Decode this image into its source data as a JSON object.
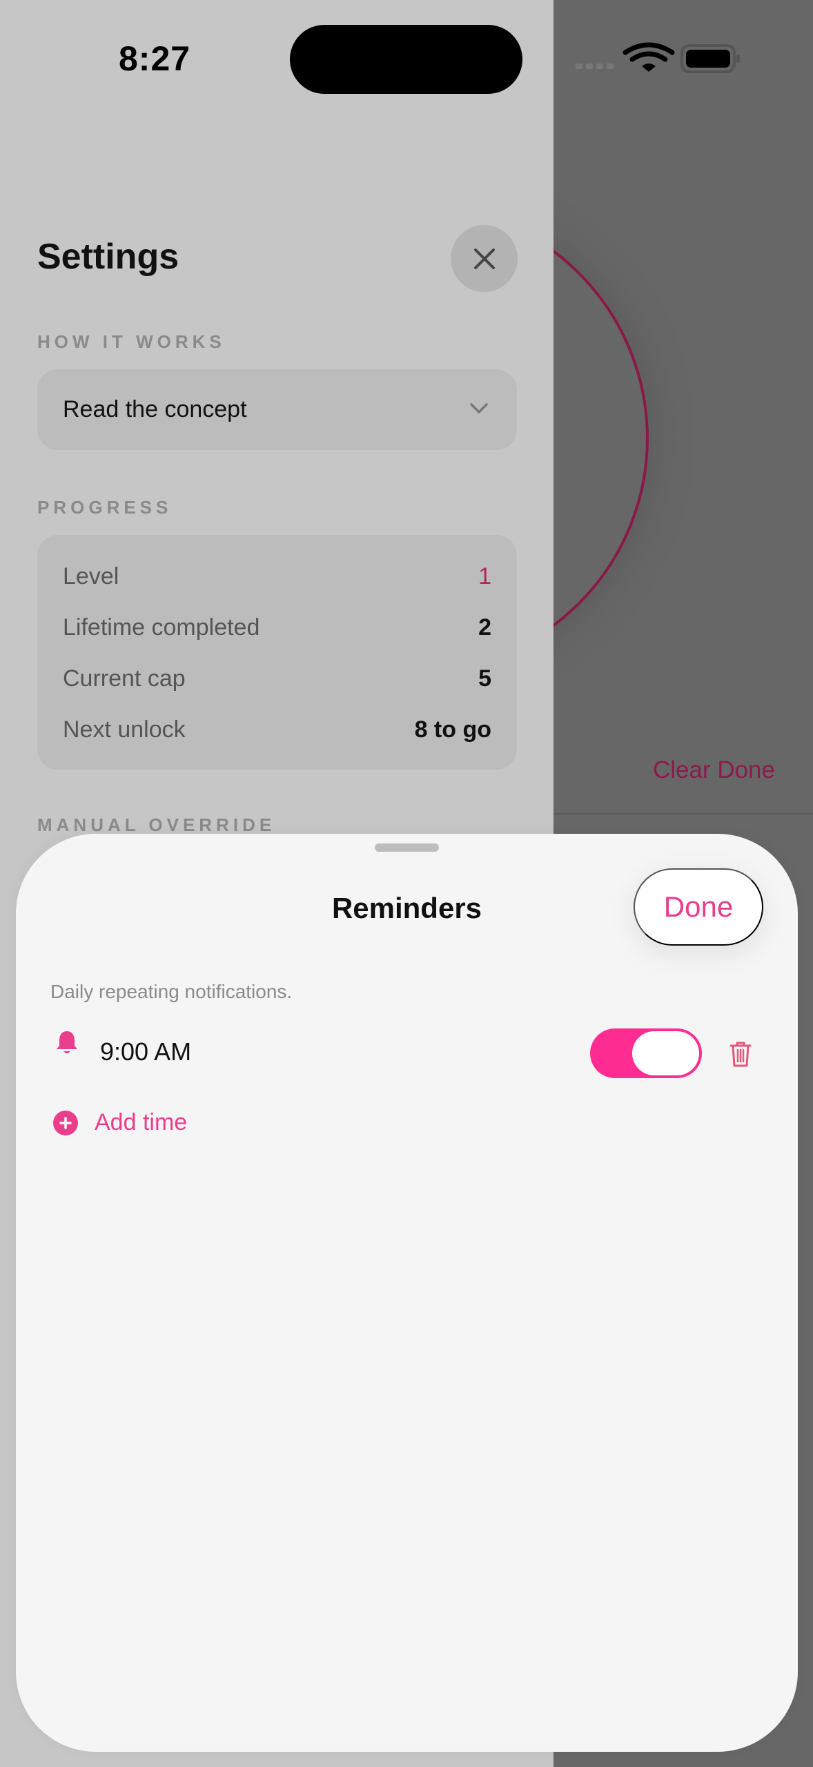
{
  "status_bar": {
    "time": "8:27"
  },
  "background_app": {
    "clear_done_label": "Clear Done",
    "accent_color": "#8c1a4c"
  },
  "settings": {
    "title": "Settings",
    "how_it_works": {
      "section_label": "HOW IT WORKS",
      "concept_label": "Read the concept"
    },
    "progress": {
      "section_label": "PROGRESS",
      "rows": [
        {
          "label": "Level",
          "value": "1"
        },
        {
          "label": "Lifetime completed",
          "value": "2"
        },
        {
          "label": "Current cap",
          "value": "5"
        },
        {
          "label": "Next unlock",
          "value": "8 to go"
        }
      ]
    },
    "manual_override_label": "MANUAL OVERRIDE"
  },
  "reminders_sheet": {
    "title": "Reminders",
    "done_label": "Done",
    "subtitle": "Daily repeating notifications.",
    "reminders": [
      {
        "time": "9:00 AM",
        "enabled": true
      }
    ],
    "add_time_label": "Add time",
    "accent_color": "#ff2d92"
  }
}
